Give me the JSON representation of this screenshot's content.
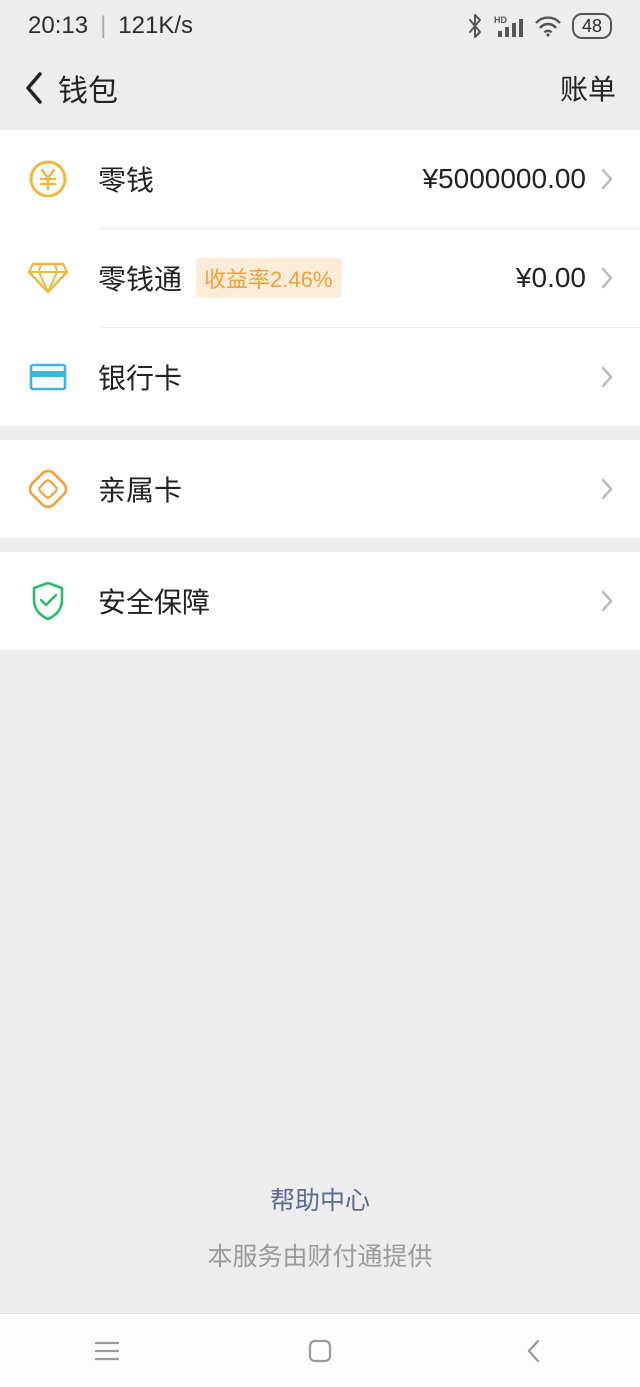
{
  "status": {
    "time": "20:13",
    "speed": "121K/s",
    "battery": "48"
  },
  "header": {
    "title": "钱包",
    "right": "账单"
  },
  "rows": {
    "change": {
      "label": "零钱",
      "value": "¥5000000.00"
    },
    "lqt": {
      "label": "零钱通",
      "badge": "收益率2.46%",
      "value": "¥0.00"
    },
    "bank": {
      "label": "银行卡"
    },
    "family": {
      "label": "亲属卡"
    },
    "security": {
      "label": "安全保障"
    }
  },
  "footer": {
    "help": "帮助中心",
    "provider": "本服务由财付通提供"
  }
}
